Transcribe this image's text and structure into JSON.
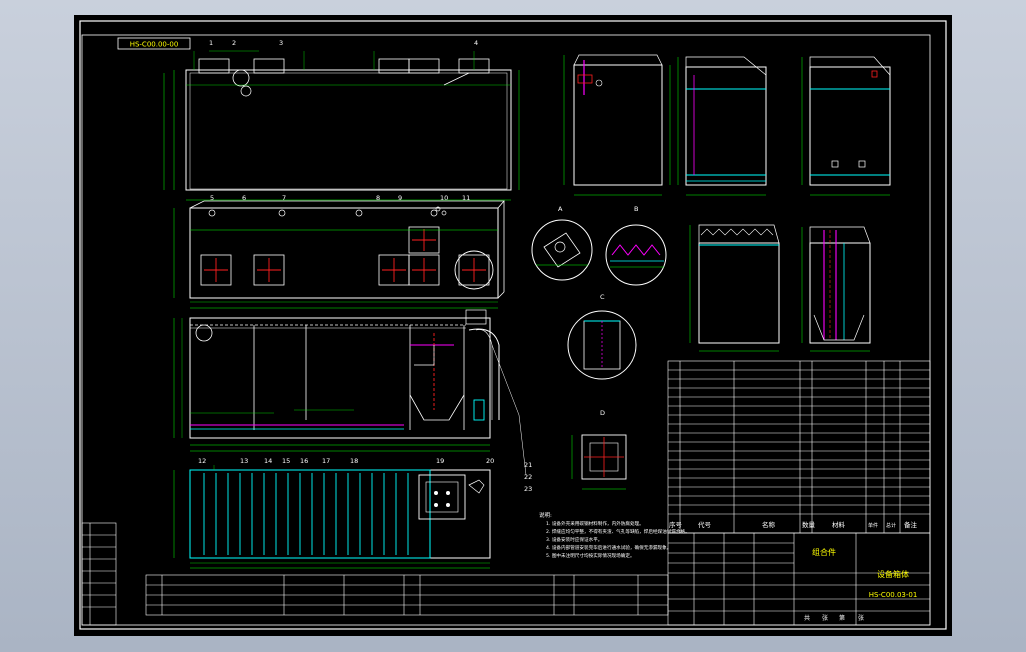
{
  "drawing": {
    "stamp": "HS-C00.00-00",
    "balloons": {
      "top": [
        "1",
        "2",
        "3",
        "4"
      ],
      "plan": [
        "5",
        "6",
        "7",
        "8",
        "9",
        "10",
        "11"
      ],
      "bottom": [
        "12",
        "13",
        "14",
        "15",
        "16",
        "17",
        "18",
        "19",
        "20"
      ],
      "right": [
        "21",
        "22",
        "23"
      ]
    },
    "section_labels": [
      "A",
      "B",
      "C",
      "D"
    ],
    "notes_title": "说明:",
    "notes": [
      "1. 设备外壳采用碳钢材料制作，内外防腐处理。",
      "2. 焊缝应均匀平整，不得有夹渣、气孔等缺陷，焊后经煤油试漏合格。",
      "3. 设备安装时应保证水平。",
      "4. 设备内部管道安装完毕后进行通水试验，确保无渗漏现象。",
      "5. 图中未注明尺寸均按实际情况现场确定。"
    ],
    "bom_header": [
      "序号",
      "代号",
      "名称",
      "数量",
      "材料",
      "单件",
      "总计",
      "备注"
    ],
    "title_block": {
      "assembly_label": "组合件",
      "drawing_name": "设备箱体",
      "drawing_number": "HS-C00.03-01",
      "footer_cells": [
        "共",
        "张",
        "第",
        "张"
      ]
    },
    "colors": {
      "background": "#000000",
      "frame": "#ffffff",
      "dimension": "#00ff00",
      "accent": "#00ffff",
      "highlight": "#ff00ff",
      "warning": "#ff2020",
      "text": "#ffff00"
    }
  }
}
